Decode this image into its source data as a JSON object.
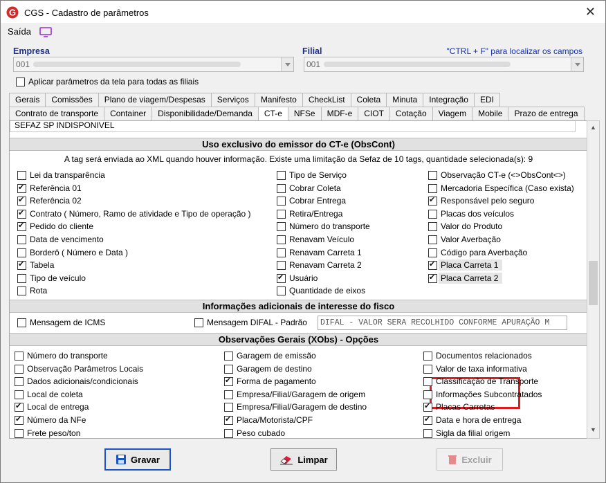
{
  "window": {
    "title": "CGS - Cadastro de parâmetros"
  },
  "menu": {
    "saida": "Saída"
  },
  "header": {
    "empresa_label": "Empresa",
    "empresa_value": "001",
    "filial_label": "Filial",
    "filial_value": "001",
    "hint": "\"CTRL + F\" para localizar os campos",
    "apply_all_label": "Aplicar parâmetros da tela para todas as filiais",
    "apply_all_checked": false
  },
  "tabs_row1": [
    "Gerais",
    "Comissões",
    "Plano de viagem/Despesas",
    "Serviços",
    "Manifesto",
    "CheckList",
    "Coleta",
    "Minuta",
    "Integração",
    "EDI"
  ],
  "tabs_row2": [
    "Contrato de transporte",
    "Container",
    "Disponibilidade/Demanda",
    "CT-e",
    "NFSe",
    "MDF-e",
    "CIOT",
    "Cotação",
    "Viagem",
    "Mobile",
    "Prazo de entrega"
  ],
  "active_tab": "CT-e",
  "prev_line": "SEFAZ SP INDISPONIVEL",
  "section1": {
    "title": "Uso exclusivo do emissor do CT-e (ObsCont)",
    "info": "A tag será enviada ao XML quando houver informação. Existe uma limitação da Sefaz de 10 tags, quantidade selecionada(s): 9",
    "col1": [
      {
        "label": "Lei da transparência",
        "checked": false
      },
      {
        "label": "Referência 01",
        "checked": true
      },
      {
        "label": "Referência 02",
        "checked": true
      },
      {
        "label": "Contrato ( Número, Ramo de atividade e Tipo de operação )",
        "checked": true
      },
      {
        "label": "Pedido do cliente",
        "checked": true
      },
      {
        "label": "Data de vencimento",
        "checked": false
      },
      {
        "label": "Borderô ( Número e Data )",
        "checked": false
      },
      {
        "label": "Tabela",
        "checked": true
      },
      {
        "label": "Tipo de veículo",
        "checked": false
      },
      {
        "label": "Rota",
        "checked": false
      }
    ],
    "col2": [
      {
        "label": "Tipo de Serviço",
        "checked": false
      },
      {
        "label": "Cobrar Coleta",
        "checked": false
      },
      {
        "label": "Cobrar Entrega",
        "checked": false
      },
      {
        "label": "Retira/Entrega",
        "checked": false
      },
      {
        "label": "Número do transporte",
        "checked": false
      },
      {
        "label": "Renavam Veículo",
        "checked": false
      },
      {
        "label": "Renavam Carreta 1",
        "checked": false
      },
      {
        "label": "Renavam Carreta 2",
        "checked": false
      },
      {
        "label": "Usuário",
        "checked": true
      },
      {
        "label": "Quantidade de eixos",
        "checked": false
      }
    ],
    "col3": [
      {
        "label": "Observação CT-e (<>ObsCont<>)",
        "checked": false
      },
      {
        "label": "Mercadoria Específica (Caso exista)",
        "checked": false
      },
      {
        "label": "Responsável pelo seguro",
        "checked": true
      },
      {
        "label": "Placas dos veículos",
        "checked": false
      },
      {
        "label": "Valor do Produto",
        "checked": false
      },
      {
        "label": "Valor Averbação",
        "checked": false
      },
      {
        "label": "Código para Averbação",
        "checked": false
      },
      {
        "label": "Placa Carreta 1",
        "checked": true
      },
      {
        "label": "Placa Carreta 2",
        "checked": true
      }
    ]
  },
  "section2": {
    "title": "Informações adicionais de interesse do fisco",
    "icms_label": "Mensagem de ICMS",
    "icms_checked": false,
    "difal_label": "Mensagem DIFAL - Padrão",
    "difal_checked": false,
    "difal_text": "DIFAL - VALOR SERA RECOLHIDO CONFORME APURAÇÃO M"
  },
  "section3": {
    "title": "Observações Gerais (XObs) - Opções",
    "col1": [
      {
        "label": "Número do transporte",
        "checked": false
      },
      {
        "label": "Observação Parâmetros Locais",
        "checked": false
      },
      {
        "label": "Dados adicionais/condicionais",
        "checked": false
      },
      {
        "label": "Local de coleta",
        "checked": false
      },
      {
        "label": "Local de entrega",
        "checked": true
      },
      {
        "label": "Número da NFe",
        "checked": true
      },
      {
        "label": "Frete peso/ton",
        "checked": false
      }
    ],
    "col2": [
      {
        "label": "Garagem de emissão",
        "checked": false
      },
      {
        "label": "Garagem de destino",
        "checked": false
      },
      {
        "label": "Forma de pagamento",
        "checked": true
      },
      {
        "label": "Empresa/Filial/Garagem de origem",
        "checked": false
      },
      {
        "label": "Empresa/Filial/Garagem de destino",
        "checked": false
      },
      {
        "label": "Placa/Motorista/CPF",
        "checked": true
      },
      {
        "label": "Peso cubado",
        "checked": false
      }
    ],
    "col3": [
      {
        "label": "Documentos relacionados",
        "checked": false
      },
      {
        "label": "Valor de taxa informativa",
        "checked": false
      },
      {
        "label": "Classificação de Transporte",
        "checked": false
      },
      {
        "label": "Informações Subcontratados",
        "checked": false
      },
      {
        "label": "Placas Carretas",
        "checked": true
      },
      {
        "label": "Data e hora de entrega",
        "checked": true
      },
      {
        "label": "Sigla da filial origem",
        "checked": false
      }
    ]
  },
  "buttons": {
    "gravar": "Gravar",
    "limpar": "Limpar",
    "excluir": "Excluir"
  },
  "colors": {
    "accent": "#1a55c8",
    "label_blue": "#1e2f8a",
    "highlight": "#dd1e1e",
    "logo": "#d12a2a"
  }
}
